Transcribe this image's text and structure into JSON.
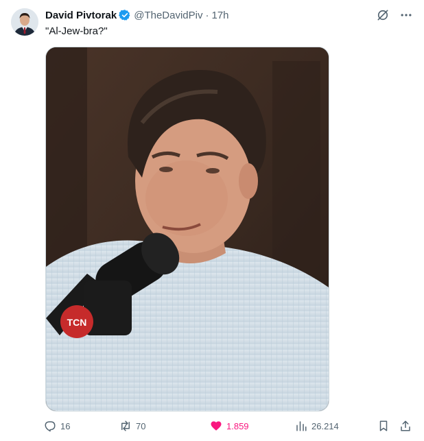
{
  "author": {
    "name": "David Pivtorak",
    "handle": "@TheDavidPiv",
    "separator": "·",
    "time": "17h",
    "verified": true
  },
  "tweet": {
    "text": "\"Al-Jew-bra?\""
  },
  "media": {
    "mic_logo_text": "TCN"
  },
  "metrics": {
    "replies": "16",
    "reposts": "70",
    "likes": "1.859",
    "views": "26.214"
  },
  "colors": {
    "like": "#f91880",
    "muted": "#536471",
    "verified": "#1d9bf0"
  },
  "icons": [
    "grok-icon",
    "more-icon",
    "reply-icon",
    "repost-icon",
    "heart-icon",
    "views-icon",
    "bookmark-icon",
    "share-icon",
    "verified-badge-icon"
  ]
}
